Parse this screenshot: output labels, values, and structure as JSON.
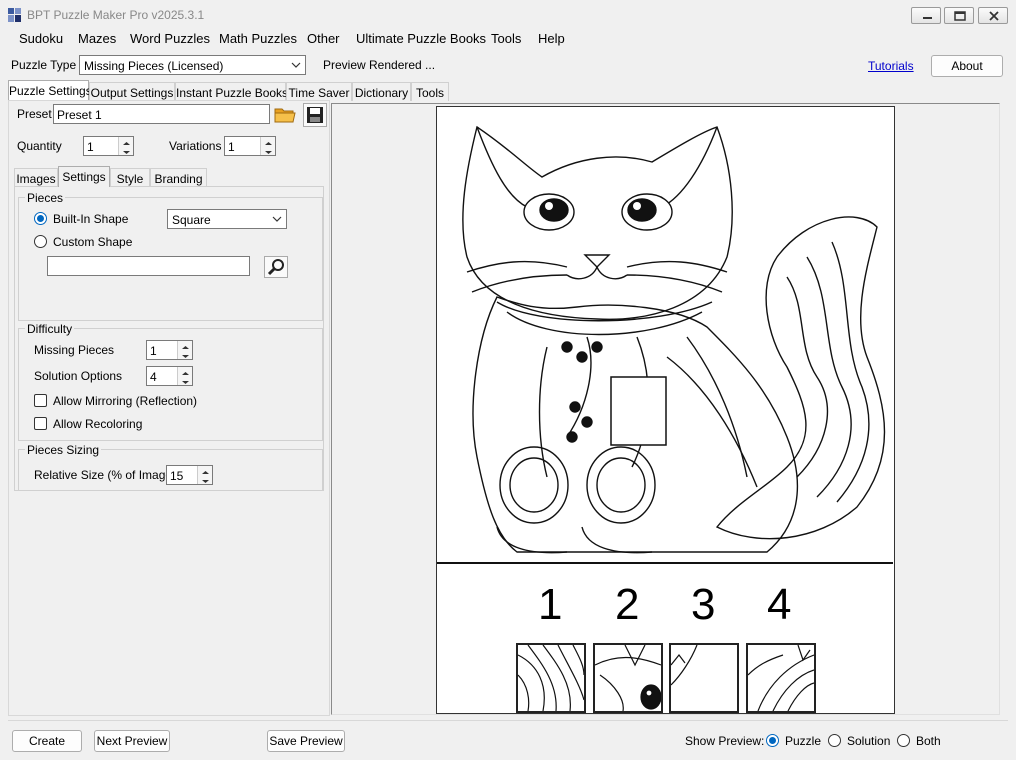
{
  "window": {
    "title": "BPT Puzzle Maker Pro v2025.3.1"
  },
  "menu": [
    "Sudoku",
    "Mazes",
    "Word Puzzles",
    "Math Puzzles",
    "Other",
    "Ultimate Puzzle Books",
    "Tools",
    "Help"
  ],
  "puzzle_type": {
    "label": "Puzzle Type",
    "value": "Missing Pieces (Licensed)",
    "status": "Preview Rendered ...",
    "tutorials": "Tutorials",
    "about": "About"
  },
  "main_tabs": [
    "Puzzle Settings",
    "Output Settings",
    "Instant Puzzle Books",
    "Time Saver",
    "Dictionary",
    "Tools"
  ],
  "preset": {
    "label": "Preset",
    "value": "Preset 1"
  },
  "quantity": {
    "label": "Quantity",
    "value": "1"
  },
  "variations": {
    "label": "Variations",
    "value": "1"
  },
  "sub_tabs": [
    "Images",
    "Settings",
    "Style",
    "Branding"
  ],
  "pieces": {
    "title": "Pieces",
    "builtin_label": "Built-In Shape",
    "builtin_value": "Square",
    "custom_label": "Custom Shape",
    "custom_value": ""
  },
  "difficulty": {
    "title": "Difficulty",
    "missing_label": "Missing Pieces",
    "missing_value": "1",
    "options_label": "Solution Options",
    "options_value": "4",
    "mirroring_label": "Allow Mirroring (Reflection)",
    "recoloring_label": "Allow Recoloring"
  },
  "sizing": {
    "title": "Pieces Sizing",
    "relative_label": "Relative Size (% of Image)",
    "relative_value": "15"
  },
  "preview": {
    "options": [
      "1",
      "2",
      "3",
      "4"
    ]
  },
  "bottom": {
    "create": "Create",
    "next_preview": "Next Preview",
    "save_preview": "Save Preview",
    "show_preview_label": "Show Preview:",
    "show_options": [
      "Puzzle",
      "Solution",
      "Both"
    ],
    "show_selected": "Puzzle"
  },
  "colors": {
    "accent": "#0067c0",
    "link": "#0000cc",
    "folder": "#e8a020"
  }
}
